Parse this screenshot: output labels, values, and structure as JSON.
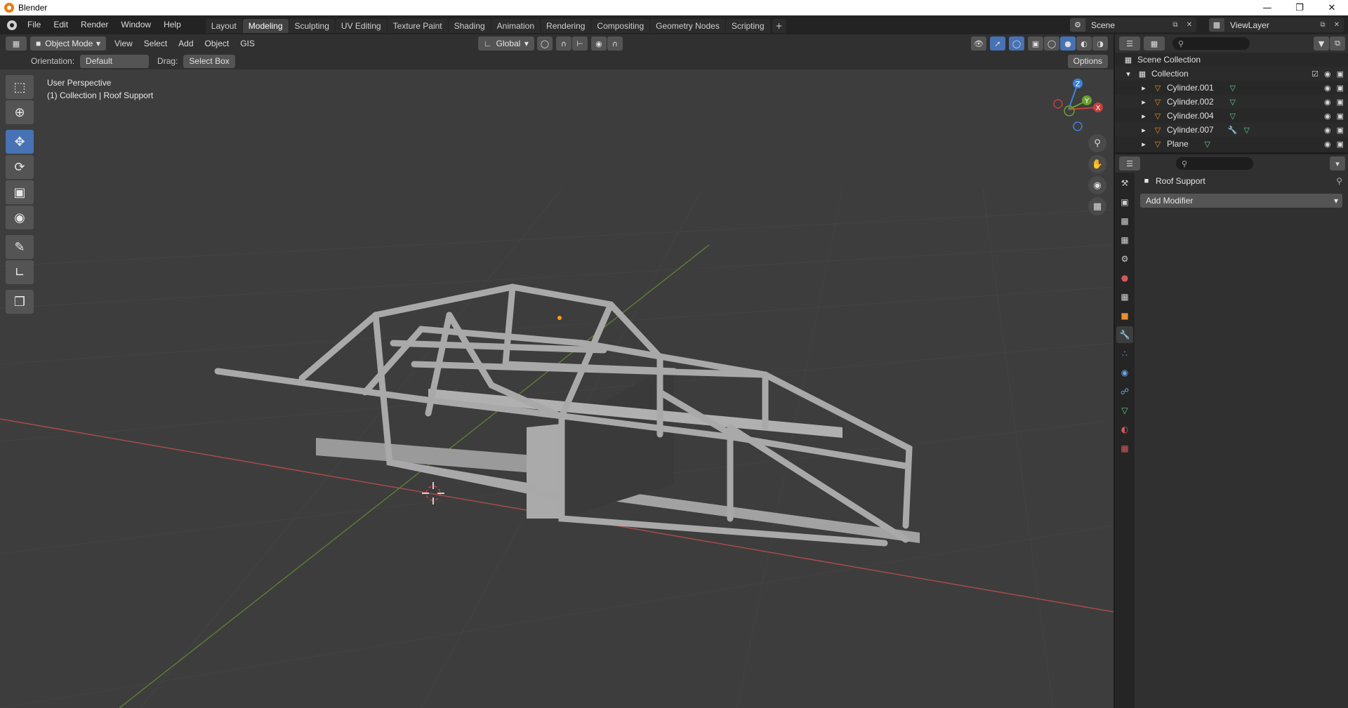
{
  "window": {
    "title": "Blender"
  },
  "menu": [
    "File",
    "Edit",
    "Render",
    "Window",
    "Help"
  ],
  "workspaces": [
    "Layout",
    "Modeling",
    "Sculpting",
    "UV Editing",
    "Texture Paint",
    "Shading",
    "Animation",
    "Rendering",
    "Compositing",
    "Geometry Nodes",
    "Scripting"
  ],
  "active_workspace": "Modeling",
  "scene": "Scene",
  "view_layer": "ViewLayer",
  "viewport": {
    "mode": "Object Mode",
    "menus": [
      "View",
      "Select",
      "Add",
      "Object",
      "GIS"
    ],
    "transform_orientation": "Global",
    "orientation_label": "Orientation:",
    "orientation_value": "Default",
    "drag_label": "Drag:",
    "drag_value": "Select Box",
    "options_label": "Options",
    "info_line1": "User Perspective",
    "info_line2": "(1) Collection | Roof Support",
    "axis": {
      "x": "X",
      "y": "Y",
      "z": "Z"
    }
  },
  "outliner": {
    "root": "Scene Collection",
    "collection": "Collection",
    "objects": [
      {
        "name": "Cylinder.001"
      },
      {
        "name": "Cylinder.002"
      },
      {
        "name": "Cylinder.004"
      },
      {
        "name": "Cylinder.007"
      },
      {
        "name": "Plane"
      }
    ]
  },
  "properties": {
    "object_name": "Roof Support",
    "add_modifier": "Add Modifier"
  },
  "colors": {
    "accent": "#4772b3",
    "object_orange": "#e8902e",
    "mesh_green": "#5fd08c",
    "x_axis": "#c8403c",
    "y_axis": "#6aa22a",
    "z_axis": "#3f82dc"
  }
}
